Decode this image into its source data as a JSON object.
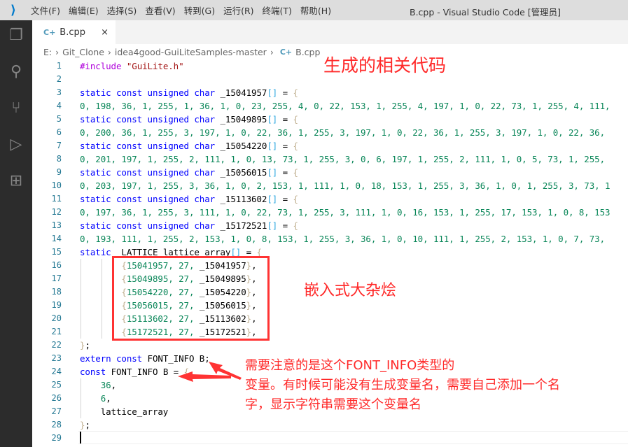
{
  "titlebar": {
    "menus": [
      "文件(F)",
      "编辑(E)",
      "选择(S)",
      "查看(V)",
      "转到(G)",
      "运行(R)",
      "终端(T)",
      "帮助(H)"
    ],
    "title": "B.cpp - Visual Studio Code [管理员]"
  },
  "activity_bar": [
    "explorer-icon",
    "search-icon",
    "source-control-icon",
    "run-debug-icon",
    "extensions-icon"
  ],
  "tab": {
    "label": "B.cpp",
    "close": "×"
  },
  "breadcrumb": [
    "E:",
    "Git_Clone",
    "idea4good-GuiLiteSamples-master",
    "B.cpp"
  ],
  "editor": {
    "lines": [
      [
        [
          "pre",
          "#include "
        ],
        [
          "str",
          "\"GuiLite.h\""
        ]
      ],
      [],
      [
        [
          "kw",
          "static const unsigned char "
        ],
        [
          "id",
          "_15041957"
        ],
        [
          "sq",
          "[]"
        ],
        [
          "id",
          " = "
        ],
        [
          "br",
          "{"
        ]
      ],
      [
        [
          "num",
          "0, 198, 36, 1, 255, 1, 36, 1, 0, 23, 255, 4, 0, 22, 153, 1, 255, 4, 197, 1, 0, 22, 73, 1, 255, 4, 111,"
        ]
      ],
      [
        [
          "kw",
          "static const unsigned char "
        ],
        [
          "id",
          "_15049895"
        ],
        [
          "sq",
          "[]"
        ],
        [
          "id",
          " = "
        ],
        [
          "br",
          "{"
        ]
      ],
      [
        [
          "num",
          "0, 200, 36, 1, 255, 3, 197, 1, 0, 22, 36, 1, 255, 3, 197, 1, 0, 22, 36, 1, 255, 3, 197, 1, 0, 22, 36,"
        ]
      ],
      [
        [
          "kw",
          "static const unsigned char "
        ],
        [
          "id",
          "_15054220"
        ],
        [
          "sq",
          "[]"
        ],
        [
          "id",
          " = "
        ],
        [
          "br",
          "{"
        ]
      ],
      [
        [
          "num",
          "0, 201, 197, 1, 255, 2, 111, 1, 0, 13, 73, 1, 255, 3, 0, 6, 197, 1, 255, 2, 111, 1, 0, 5, 73, 1, 255,"
        ]
      ],
      [
        [
          "kw",
          "static const unsigned char "
        ],
        [
          "id",
          "_15056015"
        ],
        [
          "sq",
          "[]"
        ],
        [
          "id",
          " = "
        ],
        [
          "br",
          "{"
        ]
      ],
      [
        [
          "num",
          "0, 203, 197, 1, 255, 3, 36, 1, 0, 2, 153, 1, 111, 1, 0, 18, 153, 1, 255, 3, 36, 1, 0, 1, 255, 3, 73, 1"
        ]
      ],
      [
        [
          "kw",
          "static const unsigned char "
        ],
        [
          "id",
          "_15113602"
        ],
        [
          "sq",
          "[]"
        ],
        [
          "id",
          " = "
        ],
        [
          "br",
          "{"
        ]
      ],
      [
        [
          "num",
          "0, 197, 36, 1, 255, 3, 111, 1, 0, 22, 73, 1, 255, 3, 111, 1, 0, 16, 153, 1, 255, 17, 153, 1, 0, 8, 153"
        ]
      ],
      [
        [
          "kw",
          "static const unsigned char "
        ],
        [
          "id",
          "_15172521"
        ],
        [
          "sq",
          "[]"
        ],
        [
          "id",
          " = "
        ],
        [
          "br",
          "{"
        ]
      ],
      [
        [
          "num",
          "0, 193, 111, 1, 255, 2, 153, 1, 0, 8, 153, 1, 255, 3, 36, 1, 0, 10, 111, 1, 255, 2, 153, 1, 0, 7, 73,"
        ]
      ],
      [
        [
          "kw",
          "static "
        ],
        [
          "id",
          " LATTICE lattice_array"
        ],
        [
          "sq",
          "[]"
        ],
        [
          "id",
          " = "
        ],
        [
          "br",
          "{"
        ]
      ],
      [
        [
          "id",
          "        "
        ],
        [
          "br",
          "{"
        ],
        [
          "num",
          "15041957, 27, "
        ],
        [
          "id",
          "_15041957"
        ],
        [
          "br",
          "}"
        ],
        [
          "id",
          ","
        ]
      ],
      [
        [
          "id",
          "        "
        ],
        [
          "br",
          "{"
        ],
        [
          "num",
          "15049895, 27, "
        ],
        [
          "id",
          "_15049895"
        ],
        [
          "br",
          "}"
        ],
        [
          "id",
          ","
        ]
      ],
      [
        [
          "id",
          "        "
        ],
        [
          "br",
          "{"
        ],
        [
          "num",
          "15054220, 27, "
        ],
        [
          "id",
          "_15054220"
        ],
        [
          "br",
          "}"
        ],
        [
          "id",
          ","
        ]
      ],
      [
        [
          "id",
          "        "
        ],
        [
          "br",
          "{"
        ],
        [
          "num",
          "15056015, 27, "
        ],
        [
          "id",
          "_15056015"
        ],
        [
          "br",
          "}"
        ],
        [
          "id",
          ","
        ]
      ],
      [
        [
          "id",
          "        "
        ],
        [
          "br",
          "{"
        ],
        [
          "num",
          "15113602, 27, "
        ],
        [
          "id",
          "_15113602"
        ],
        [
          "br",
          "}"
        ],
        [
          "id",
          ","
        ]
      ],
      [
        [
          "id",
          "        "
        ],
        [
          "br",
          "{"
        ],
        [
          "num",
          "15172521, 27, "
        ],
        [
          "id",
          "_15172521"
        ],
        [
          "br",
          "}"
        ],
        [
          "id",
          ","
        ]
      ],
      [
        [
          "br",
          "}"
        ],
        [
          "id",
          ";"
        ]
      ],
      [
        [
          "kw",
          "extern const "
        ],
        [
          "id",
          "FONT_INFO B;"
        ]
      ],
      [
        [
          "kw",
          "const "
        ],
        [
          "id",
          "FONT_INFO B = "
        ],
        [
          "br",
          "{"
        ]
      ],
      [
        [
          "num",
          "    36"
        ],
        [
          "id",
          ","
        ]
      ],
      [
        [
          "num",
          "    6"
        ],
        [
          "id",
          ","
        ]
      ],
      [
        [
          "id",
          "    lattice_array"
        ]
      ],
      [
        [
          "br",
          "}"
        ],
        [
          "id",
          ";"
        ]
      ],
      []
    ]
  },
  "annotations": {
    "title": "生成的相关代码",
    "box_label": "嵌入式大杂烩",
    "note": [
      "需要注意的是这个FONT_INFO类型的",
      "变量。有时候可能没有生成变量名，需要自己添加一个名",
      "字，显示字符串需要这个变量名"
    ],
    "color": "#ff2a2a"
  }
}
